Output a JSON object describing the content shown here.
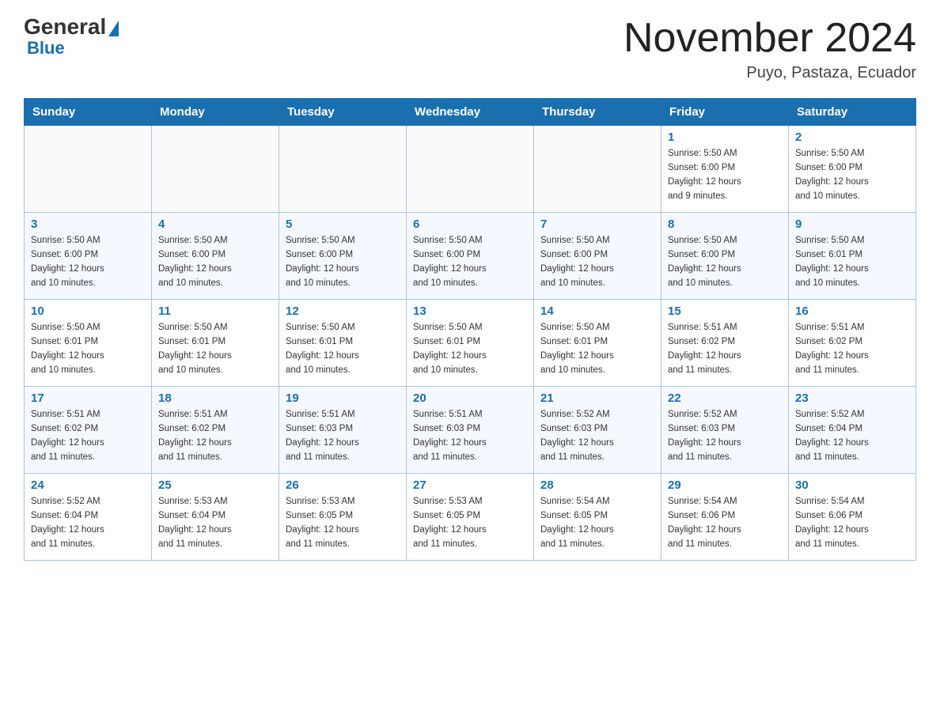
{
  "header": {
    "logo": {
      "general": "General",
      "triangle": "▶",
      "blue": "Blue"
    },
    "title": "November 2024",
    "location": "Puyo, Pastaza, Ecuador"
  },
  "days_of_week": [
    "Sunday",
    "Monday",
    "Tuesday",
    "Wednesday",
    "Thursday",
    "Friday",
    "Saturday"
  ],
  "weeks": [
    [
      {
        "day": "",
        "info": ""
      },
      {
        "day": "",
        "info": ""
      },
      {
        "day": "",
        "info": ""
      },
      {
        "day": "",
        "info": ""
      },
      {
        "day": "",
        "info": ""
      },
      {
        "day": "1",
        "info": "Sunrise: 5:50 AM\nSunset: 6:00 PM\nDaylight: 12 hours\nand 9 minutes."
      },
      {
        "day": "2",
        "info": "Sunrise: 5:50 AM\nSunset: 6:00 PM\nDaylight: 12 hours\nand 10 minutes."
      }
    ],
    [
      {
        "day": "3",
        "info": "Sunrise: 5:50 AM\nSunset: 6:00 PM\nDaylight: 12 hours\nand 10 minutes."
      },
      {
        "day": "4",
        "info": "Sunrise: 5:50 AM\nSunset: 6:00 PM\nDaylight: 12 hours\nand 10 minutes."
      },
      {
        "day": "5",
        "info": "Sunrise: 5:50 AM\nSunset: 6:00 PM\nDaylight: 12 hours\nand 10 minutes."
      },
      {
        "day": "6",
        "info": "Sunrise: 5:50 AM\nSunset: 6:00 PM\nDaylight: 12 hours\nand 10 minutes."
      },
      {
        "day": "7",
        "info": "Sunrise: 5:50 AM\nSunset: 6:00 PM\nDaylight: 12 hours\nand 10 minutes."
      },
      {
        "day": "8",
        "info": "Sunrise: 5:50 AM\nSunset: 6:00 PM\nDaylight: 12 hours\nand 10 minutes."
      },
      {
        "day": "9",
        "info": "Sunrise: 5:50 AM\nSunset: 6:01 PM\nDaylight: 12 hours\nand 10 minutes."
      }
    ],
    [
      {
        "day": "10",
        "info": "Sunrise: 5:50 AM\nSunset: 6:01 PM\nDaylight: 12 hours\nand 10 minutes."
      },
      {
        "day": "11",
        "info": "Sunrise: 5:50 AM\nSunset: 6:01 PM\nDaylight: 12 hours\nand 10 minutes."
      },
      {
        "day": "12",
        "info": "Sunrise: 5:50 AM\nSunset: 6:01 PM\nDaylight: 12 hours\nand 10 minutes."
      },
      {
        "day": "13",
        "info": "Sunrise: 5:50 AM\nSunset: 6:01 PM\nDaylight: 12 hours\nand 10 minutes."
      },
      {
        "day": "14",
        "info": "Sunrise: 5:50 AM\nSunset: 6:01 PM\nDaylight: 12 hours\nand 10 minutes."
      },
      {
        "day": "15",
        "info": "Sunrise: 5:51 AM\nSunset: 6:02 PM\nDaylight: 12 hours\nand 11 minutes."
      },
      {
        "day": "16",
        "info": "Sunrise: 5:51 AM\nSunset: 6:02 PM\nDaylight: 12 hours\nand 11 minutes."
      }
    ],
    [
      {
        "day": "17",
        "info": "Sunrise: 5:51 AM\nSunset: 6:02 PM\nDaylight: 12 hours\nand 11 minutes."
      },
      {
        "day": "18",
        "info": "Sunrise: 5:51 AM\nSunset: 6:02 PM\nDaylight: 12 hours\nand 11 minutes."
      },
      {
        "day": "19",
        "info": "Sunrise: 5:51 AM\nSunset: 6:03 PM\nDaylight: 12 hours\nand 11 minutes."
      },
      {
        "day": "20",
        "info": "Sunrise: 5:51 AM\nSunset: 6:03 PM\nDaylight: 12 hours\nand 11 minutes."
      },
      {
        "day": "21",
        "info": "Sunrise: 5:52 AM\nSunset: 6:03 PM\nDaylight: 12 hours\nand 11 minutes."
      },
      {
        "day": "22",
        "info": "Sunrise: 5:52 AM\nSunset: 6:03 PM\nDaylight: 12 hours\nand 11 minutes."
      },
      {
        "day": "23",
        "info": "Sunrise: 5:52 AM\nSunset: 6:04 PM\nDaylight: 12 hours\nand 11 minutes."
      }
    ],
    [
      {
        "day": "24",
        "info": "Sunrise: 5:52 AM\nSunset: 6:04 PM\nDaylight: 12 hours\nand 11 minutes."
      },
      {
        "day": "25",
        "info": "Sunrise: 5:53 AM\nSunset: 6:04 PM\nDaylight: 12 hours\nand 11 minutes."
      },
      {
        "day": "26",
        "info": "Sunrise: 5:53 AM\nSunset: 6:05 PM\nDaylight: 12 hours\nand 11 minutes."
      },
      {
        "day": "27",
        "info": "Sunrise: 5:53 AM\nSunset: 6:05 PM\nDaylight: 12 hours\nand 11 minutes."
      },
      {
        "day": "28",
        "info": "Sunrise: 5:54 AM\nSunset: 6:05 PM\nDaylight: 12 hours\nand 11 minutes."
      },
      {
        "day": "29",
        "info": "Sunrise: 5:54 AM\nSunset: 6:06 PM\nDaylight: 12 hours\nand 11 minutes."
      },
      {
        "day": "30",
        "info": "Sunrise: 5:54 AM\nSunset: 6:06 PM\nDaylight: 12 hours\nand 11 minutes."
      }
    ]
  ]
}
